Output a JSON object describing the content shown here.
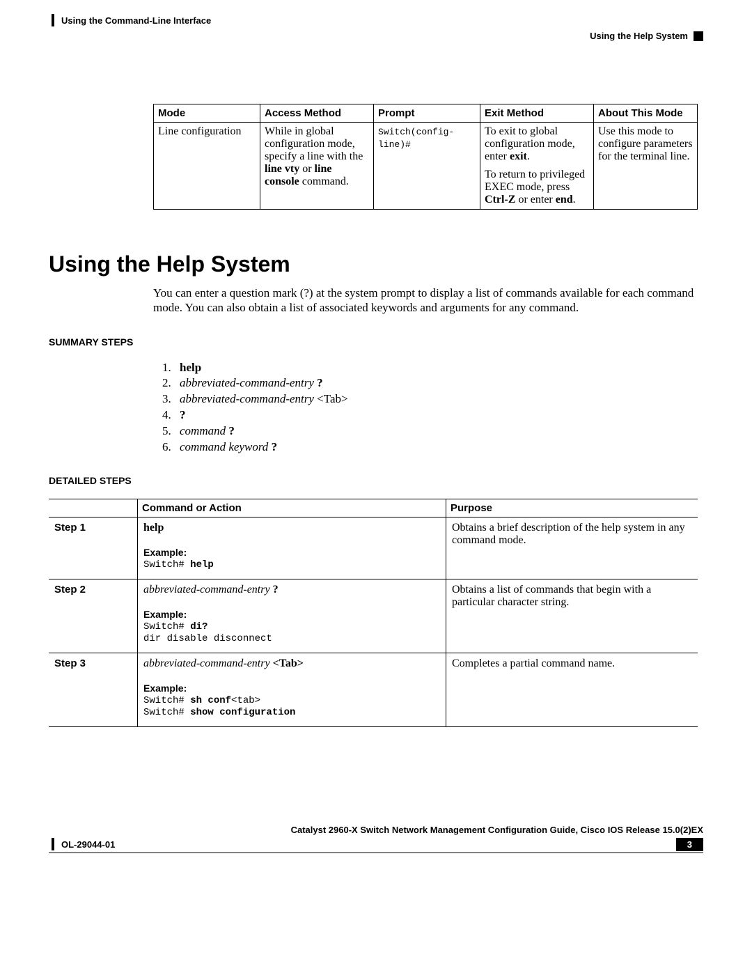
{
  "header": {
    "chapter": "Using the Command-Line Interface",
    "section": "Using the Help System"
  },
  "mode_table": {
    "headers": [
      "Mode",
      "Access Method",
      "Prompt",
      "Exit Method",
      "About This Mode"
    ],
    "row": {
      "mode": "Line configuration",
      "access_pre": "While in global configuration mode, specify a line with the ",
      "access_cmd1": "line vty",
      "access_mid": " or ",
      "access_cmd2": "line console",
      "access_post": " command.",
      "prompt": "Switch(config-line)#",
      "exit_p1_pre": "To exit to global configuration mode, enter ",
      "exit_p1_cmd": "exit",
      "exit_p1_post": ".",
      "exit_p2_pre": "To return to privileged EXEC mode, press ",
      "exit_p2_cmd1": "Ctrl-Z",
      "exit_p2_mid": " or enter ",
      "exit_p2_cmd2": "end",
      "exit_p2_post": ".",
      "about": "Use this mode to configure parameters for the terminal line."
    }
  },
  "heading": "Using the Help System",
  "intro": "You can enter a question mark (?) at the system prompt to display a list of commands available for each command mode. You can also obtain a list of associated keywords and arguments for any command.",
  "summary_label": "SUMMARY STEPS",
  "summary": [
    {
      "bold": "help",
      "ital": "",
      "rest": ""
    },
    {
      "bold": "",
      "ital": "abbreviated-command-entry",
      "rest": " ?"
    },
    {
      "bold": "",
      "ital": "abbreviated-command-entry",
      "rest": " <Tab>"
    },
    {
      "bold": "?",
      "ital": "",
      "rest": ""
    },
    {
      "bold": "",
      "ital": "command",
      "rest": " ?"
    },
    {
      "bold": "",
      "ital": "command keyword",
      "rest": " ?"
    }
  ],
  "detailed_label": "DETAILED STEPS",
  "steps_headers": [
    "",
    "Command or Action",
    "Purpose"
  ],
  "steps": [
    {
      "step": "Step 1",
      "cmd_bold": "help",
      "cmd_ital": "",
      "cmd_rest": "",
      "example_label": "Example:",
      "code_html": "Switch# <b>help</b>",
      "purpose": "Obtains a brief description of the help system in any command mode."
    },
    {
      "step": "Step 2",
      "cmd_bold": "",
      "cmd_ital": "abbreviated-command-entry",
      "cmd_rest": " ?",
      "example_label": "Example:",
      "code_html": "Switch# <b>di?</b>\ndir disable disconnect",
      "purpose": "Obtains a list of commands that begin with a particular character string."
    },
    {
      "step": "Step 3",
      "cmd_bold": "",
      "cmd_ital": "abbreviated-command-entry",
      "cmd_rest": " <Tab>",
      "example_label": "Example:",
      "code_html": "Switch# <b>sh conf</b>&lt;tab&gt;\nSwitch# <b>show configuration</b>",
      "purpose": "Completes a partial command name."
    }
  ],
  "footer": {
    "doc_title": "Catalyst 2960-X Switch Network Management Configuration Guide, Cisco IOS Release 15.0(2)EX",
    "doc_id": "OL-29044-01",
    "page": "3"
  }
}
